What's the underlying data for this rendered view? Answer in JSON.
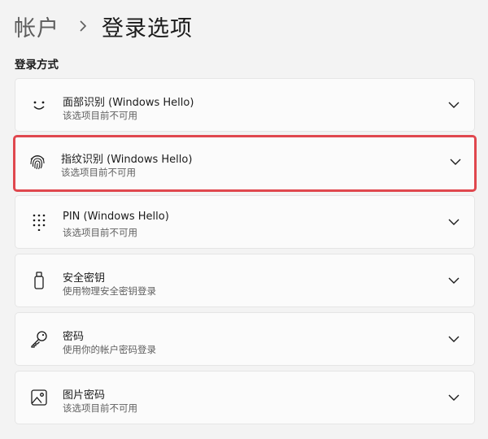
{
  "breadcrumb": {
    "parent": "帐户",
    "current": "登录选项"
  },
  "section": {
    "label": "登录方式"
  },
  "options": [
    {
      "title": "面部识别 (Windows Hello)",
      "subtitle": "该选项目前不可用",
      "icon": "face-smile-icon"
    },
    {
      "title": "指纹识别 (Windows Hello)",
      "subtitle": "该选项目前不可用",
      "icon": "fingerprint-icon",
      "highlighted": true
    },
    {
      "title": "PIN (Windows Hello)",
      "subtitle": "该选项目前不可用",
      "icon": "keypad-icon"
    },
    {
      "title": "安全密钥",
      "subtitle": "使用物理安全密钥登录",
      "icon": "usb-key-icon"
    },
    {
      "title": "密码",
      "subtitle": "使用你的帐户密码登录",
      "icon": "key-icon"
    },
    {
      "title": "图片密码",
      "subtitle": "该选项目前不可用",
      "icon": "picture-icon"
    }
  ],
  "colors": {
    "highlight_border": "#e0474e",
    "background": "#f3f3f3",
    "card": "#fbfbfb"
  }
}
